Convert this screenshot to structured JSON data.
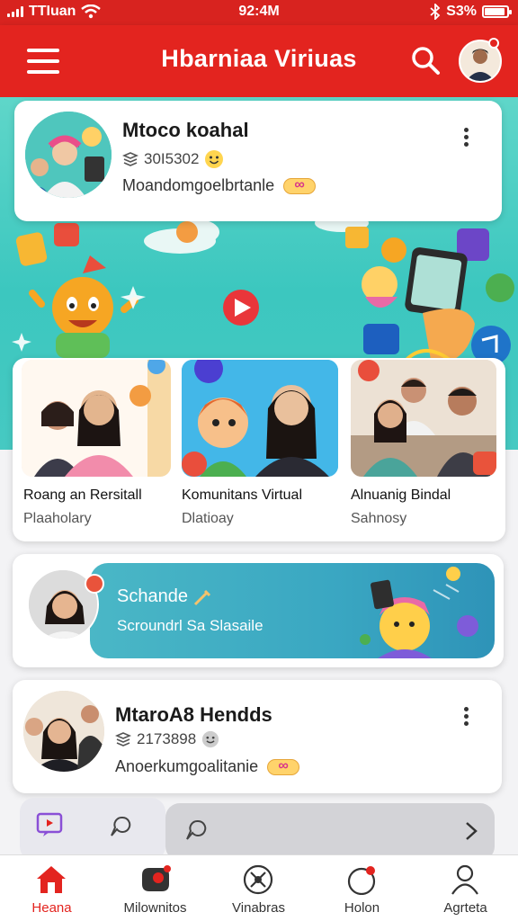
{
  "status_bar": {
    "carrier": "TTIuan",
    "time": "92:4M",
    "battery": "S3%"
  },
  "header": {
    "title": "Hbarniaa Viriuas"
  },
  "profile_card_1": {
    "name": "Mtoco koahal",
    "meta": "30I5302",
    "subtitle": "Moandomgoelbrtanle"
  },
  "communities": [
    {
      "title": "Roang an Rersitall",
      "subtitle": "Plaaholary"
    },
    {
      "title": "Komunitans Virtual",
      "subtitle": "Dlatioay"
    },
    {
      "title": "Alnuanig Bindal",
      "subtitle": "Sahnosy"
    }
  ],
  "banner": {
    "title": "Schande",
    "subtitle": "Scroundrl Sa Slasaile"
  },
  "profile_card_2": {
    "name": "MtaroA8 Hendds",
    "meta": "2173898",
    "subtitle": "Anoerkumgoalitanie"
  },
  "bottom_nav": [
    {
      "label": "Heana",
      "icon": "home-icon",
      "active": true
    },
    {
      "label": "Milownitos",
      "icon": "community-icon",
      "active": false
    },
    {
      "label": "Vinabras",
      "icon": "explore-icon",
      "active": false
    },
    {
      "label": "Holon",
      "icon": "notification-icon",
      "active": false
    },
    {
      "label": "Agrteta",
      "icon": "profile-icon",
      "active": false
    }
  ],
  "colors": {
    "brand_red": "#e3241f",
    "hero_teal": "#3cc7bf",
    "banner_blue": "#3aa7c2"
  }
}
